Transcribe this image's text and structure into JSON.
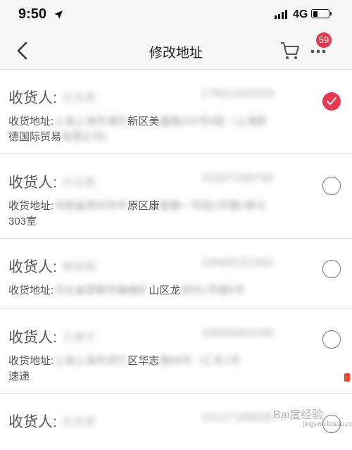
{
  "status_bar": {
    "time": "9:50",
    "network": "4G",
    "battery_level": 0.3,
    "icons": [
      "location-arrow-icon",
      "signal-icon",
      "battery-icon"
    ]
  },
  "nav": {
    "title": "修改地址",
    "cart_badge": "59",
    "icons": [
      "back-icon",
      "cart-icon",
      "more-icon"
    ]
  },
  "addresses": [
    {
      "recipient_label": "收货人:",
      "name": "庄志豪",
      "phone": "17601333333",
      "address_label": "收货地址:",
      "address_blur_left": "上海上海市浦东",
      "address_visible": "新区美",
      "address_blur_right": "盛路255号8层（上海新",
      "address_line2_visible": "德国际贸易",
      "address_line2_blur": "有限公司)",
      "selected": true
    },
    {
      "recipient_label": "收货人:",
      "name": "庄志豪",
      "phone": "15207168760",
      "address_label": "收货地址:",
      "address_blur_left": "河南省郑州市中",
      "address_visible": "原区康",
      "address_blur_right": "复路一号院1号楼2单元",
      "address_line2_visible": "303室",
      "address_line2_blur": "",
      "selected": false
    },
    {
      "recipient_label": "收货人:",
      "name": "梅淑娟",
      "phone": "15589151581",
      "address_label": "收货地址:",
      "address_blur_left": "河北省邯郸市峰峰矿",
      "address_visible": "山区龙",
      "address_blur_right": "虎村1号楼6号",
      "address_line2_visible": "",
      "address_line2_blur": "",
      "selected": false
    },
    {
      "recipient_label": "收货人:",
      "name": "王建文",
      "phone": "18656661048",
      "address_label": "收货地址:",
      "address_blur_left": "上海上海市闵行",
      "address_visible": "区华志",
      "address_blur_right": "路88号（汇丰1号",
      "address_line2_visible": "速递",
      "address_line2_blur": "",
      "selected": false
    },
    {
      "recipient_label": "收货人:",
      "name": "庄志豪",
      "phone": "15127186025",
      "address_label": "",
      "address_blur_left": "",
      "address_visible": "",
      "address_blur_right": "",
      "address_line2_visible": "",
      "address_line2_blur": "",
      "selected": false
    }
  ],
  "watermark": {
    "text": "Bai度经验",
    "sub": "jingyan.baidu.com"
  },
  "colors": {
    "accent": "#e8384f",
    "background": "#f0f0f0"
  }
}
